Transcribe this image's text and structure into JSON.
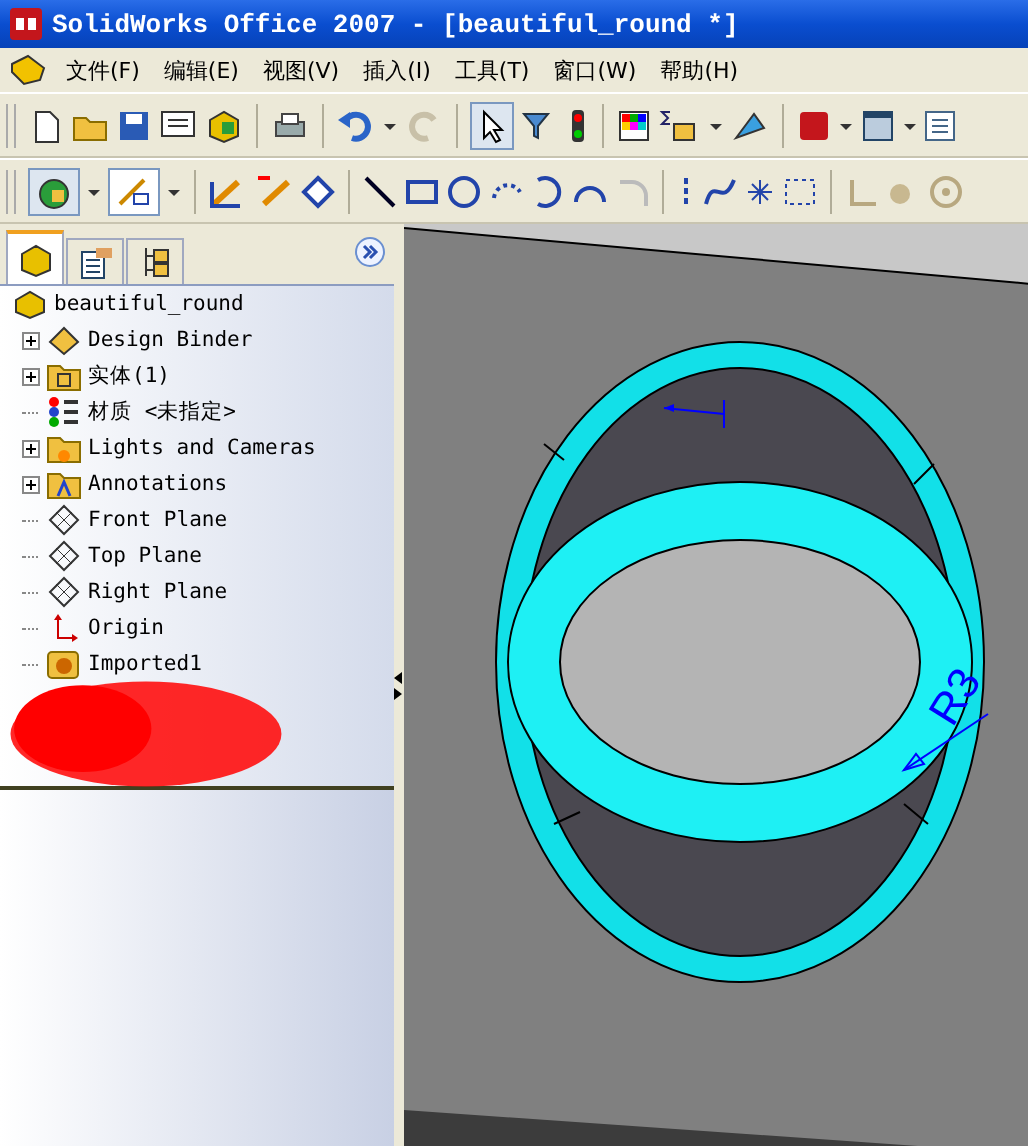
{
  "window": {
    "title": "SolidWorks Office 2007 - [beautiful_round *]"
  },
  "menu": [
    "文件(F)",
    "编辑(E)",
    "视图(V)",
    "插入(I)",
    "工具(T)",
    "窗口(W)",
    "帮助(H)"
  ],
  "panel_tabs": [
    {
      "kind": "features",
      "selected": true
    },
    {
      "kind": "properties",
      "selected": false
    },
    {
      "kind": "config",
      "selected": false
    }
  ],
  "tree": {
    "root": "beautiful_round",
    "items": [
      {
        "kind": "binder",
        "label": "Design Binder",
        "expander": true
      },
      {
        "kind": "folder",
        "label": "实体(1)",
        "expander": true
      },
      {
        "kind": "material",
        "label": "材质 <未指定>",
        "expander": false
      },
      {
        "kind": "lights",
        "label": "Lights and Cameras",
        "expander": true
      },
      {
        "kind": "annotations",
        "label": "Annotations",
        "expander": true
      },
      {
        "kind": "plane",
        "label": "Front Plane",
        "expander": false
      },
      {
        "kind": "plane",
        "label": "Top Plane",
        "expander": false
      },
      {
        "kind": "plane",
        "label": "Right Plane",
        "expander": false
      },
      {
        "kind": "origin",
        "label": "Origin",
        "expander": false
      },
      {
        "kind": "imported",
        "label": "Imported1",
        "expander": false
      }
    ]
  },
  "viewport": {
    "dimension": "R3"
  }
}
